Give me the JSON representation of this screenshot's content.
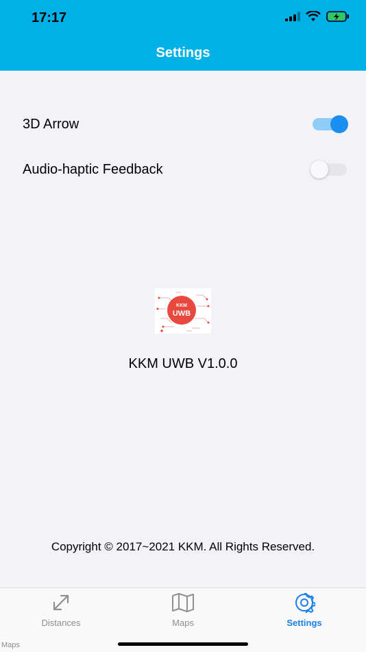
{
  "status_bar": {
    "time": "17:17"
  },
  "header": {
    "title": "Settings"
  },
  "settings": [
    {
      "label": "3D Arrow",
      "enabled": true
    },
    {
      "label": "Audio-haptic Feedback",
      "enabled": false
    }
  ],
  "logo": {
    "top_text": "KKM",
    "main_text": "UWB"
  },
  "version": "KKM UWB V1.0.0",
  "copyright": "Copyright © 2017~2021 KKM. All Rights Reserved.",
  "tabs": [
    {
      "label": "Distances",
      "icon": "expand-arrows-icon",
      "active": false
    },
    {
      "label": "Maps",
      "icon": "map-icon",
      "active": false
    },
    {
      "label": "Settings",
      "icon": "gear-icon",
      "active": true
    }
  ],
  "corner_label": "Maps",
  "colors": {
    "header_bg": "#00b1e8",
    "toggle_on": "#1a8ff0",
    "active_tab": "#1a7fe6",
    "inactive_tab": "#8e8e93",
    "logo_red": "#e8483e"
  }
}
